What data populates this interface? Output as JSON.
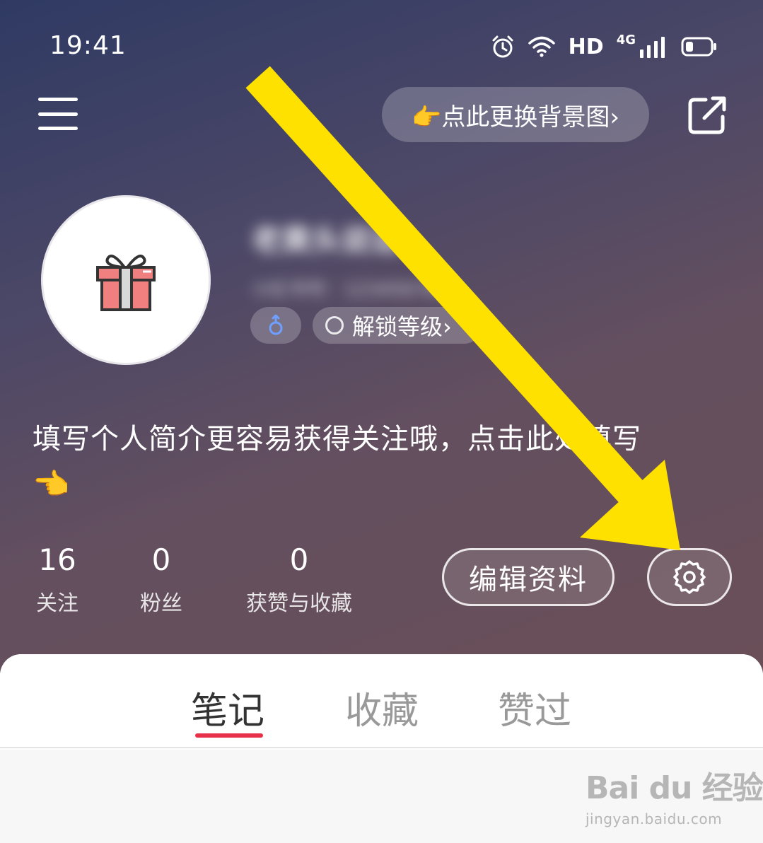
{
  "status_bar": {
    "time": "19:41",
    "hd_label": "HD",
    "network_label": "4G",
    "icons": [
      "alarm-icon",
      "wifi-icon",
      "signal-icon",
      "battery-icon"
    ]
  },
  "top_bar": {
    "menu_icon": "hamburger-menu-icon",
    "change_background_label": "👉点此更换背景图›",
    "share_icon": "share-icon"
  },
  "profile": {
    "avatar_icon": "gift-icon",
    "nickname": "老黄头说话",
    "red_id": "小红书号：123456789",
    "gender_icon": "male-icon",
    "level_label": "解锁等级›",
    "bio_prompt": "填写个人简介更容易获得关注哦，点击此处填写",
    "bio_emoji": "👈"
  },
  "stats": {
    "following_count": "16",
    "following_label": "关注",
    "fans_count": "0",
    "fans_label": "粉丝",
    "likes_count": "0",
    "likes_label": "获赞与收藏"
  },
  "actions": {
    "edit_profile_label": "编辑资料",
    "settings_icon": "gear-icon"
  },
  "tabs": [
    {
      "label": "笔记",
      "active": true
    },
    {
      "label": "收藏",
      "active": false
    },
    {
      "label": "赞过",
      "active": false
    }
  ],
  "colors": {
    "tab_active_underline": "#e8304a",
    "annotation_arrow": "#ffe100",
    "header_gradient_top": "#2f3a63",
    "header_gradient_bottom": "#6a4f58"
  },
  "watermark": {
    "main": "Bai du 经验",
    "sub": "jingyan.baidu.com"
  }
}
